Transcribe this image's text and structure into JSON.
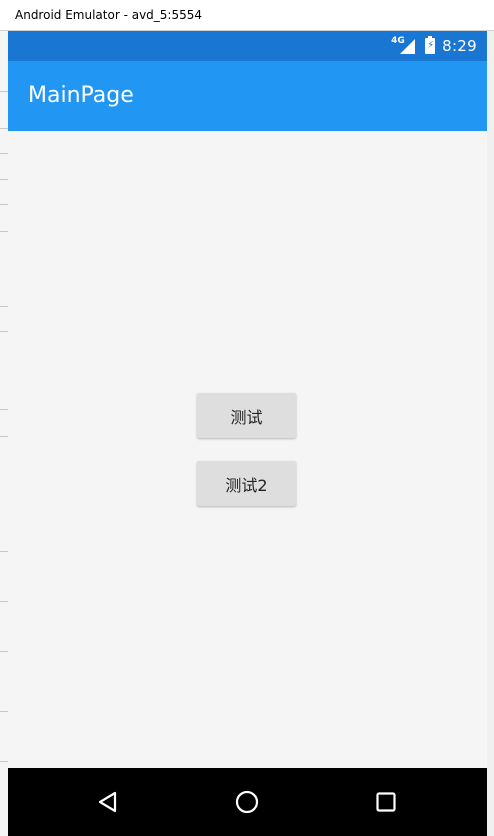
{
  "window": {
    "title": "Android Emulator - avd_5:5554"
  },
  "status_bar": {
    "network": "4G",
    "time": "8:29",
    "icons": [
      "signal-4g-icon",
      "battery-charging-icon"
    ]
  },
  "app_bar": {
    "title": "MainPage"
  },
  "buttons": [
    {
      "label": "测试"
    },
    {
      "label": "测试2"
    }
  ],
  "nav_bar": {
    "icons": [
      "back-icon",
      "home-icon",
      "recent-apps-icon"
    ]
  },
  "colors": {
    "status_bar": "#1976d2",
    "app_bar": "#2196f3",
    "content_bg": "#f5f5f5",
    "button_bg": "#dedede",
    "nav_bar": "#000000"
  }
}
